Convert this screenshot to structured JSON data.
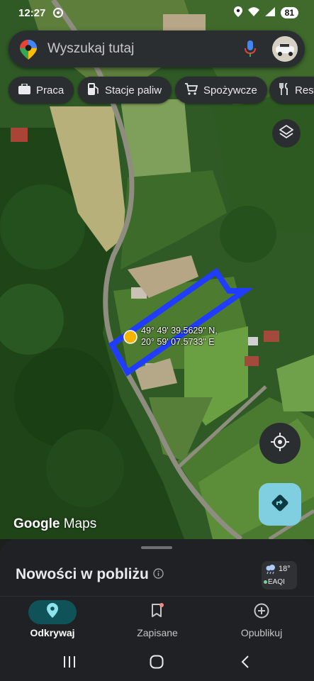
{
  "status_bar": {
    "time": "12:27",
    "battery": "81"
  },
  "search": {
    "placeholder": "Wyszukaj tutaj"
  },
  "chips": [
    {
      "label": "Praca",
      "icon": "briefcase-icon"
    },
    {
      "label": "Stacje paliw",
      "icon": "gas-station-icon"
    },
    {
      "label": "Spożywcze",
      "icon": "shopping-cart-icon"
    },
    {
      "label": "Rest",
      "icon": "restaurant-icon"
    }
  ],
  "map": {
    "coordinates_line1": "49° 49' 39.5629\" N,",
    "coordinates_line2": "20° 59' 07.5733\" E",
    "logo_google": "Google",
    "logo_maps": "Maps",
    "overlay_color": "#1f3cff"
  },
  "sheet": {
    "title": "Nowości w pobliżu",
    "weather_temp": "18°",
    "weather_aqi": "EAQI"
  },
  "nav": {
    "items": [
      {
        "label": "Odkrywaj",
        "icon": "location-pin-icon",
        "active": true
      },
      {
        "label": "Zapisane",
        "icon": "bookmark-icon",
        "active": false
      },
      {
        "label": "Opublikuj",
        "icon": "add-circle-icon",
        "active": false
      }
    ]
  },
  "colors": {
    "accent": "#0f5257",
    "directions": "#7fcfe0",
    "surface": "#2b2e31"
  }
}
